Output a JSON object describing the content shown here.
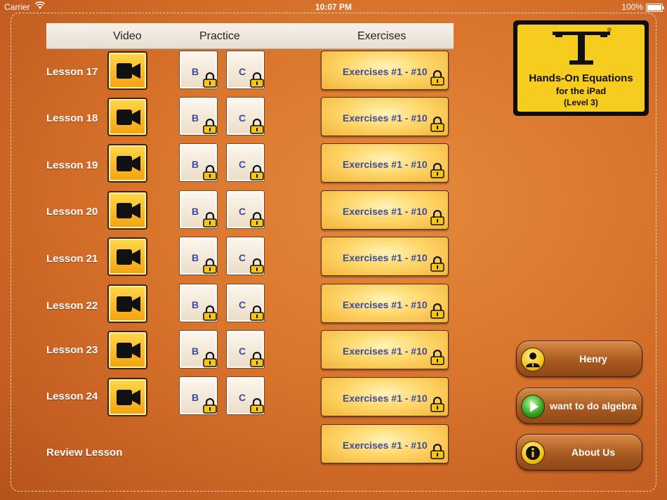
{
  "status_bar": {
    "carrier": "Carrier",
    "time": "10:07 PM",
    "battery": "100%"
  },
  "header": {
    "video": "Video",
    "practice": "Practice",
    "exercises": "Exercises"
  },
  "lessons": [
    {
      "label": "Lesson 17",
      "practice": [
        "B",
        "C"
      ],
      "exercises": "Exercises #1 - #10"
    },
    {
      "label": "Lesson 18",
      "practice": [
        "B",
        "C"
      ],
      "exercises": "Exercises #1 - #10"
    },
    {
      "label": "Lesson 19",
      "practice": [
        "B",
        "C"
      ],
      "exercises": "Exercises #1 - #10"
    },
    {
      "label": "Lesson 20",
      "practice": [
        "B",
        "C"
      ],
      "exercises": "Exercises #1 - #10"
    },
    {
      "label": "Lesson 21",
      "practice": [
        "B",
        "C"
      ],
      "exercises": "Exercises #1 - #10"
    },
    {
      "label": "Lesson 22",
      "practice": [
        "B",
        "C"
      ],
      "exercises": "Exercises #1 - #10"
    },
    {
      "label": "Lesson 23",
      "practice": [
        "B",
        "C"
      ],
      "exercises": "Exercises #1 - #10"
    },
    {
      "label": "Lesson 24",
      "practice": [
        "B",
        "C"
      ],
      "exercises": "Exercises #1 - #10"
    }
  ],
  "review": {
    "label": "Review Lesson",
    "exercises": "Exercises #1 - #10"
  },
  "logo": {
    "title": "Hands-On Equations",
    "subtitle": "for the iPad",
    "level": "(Level 3)"
  },
  "side_buttons": {
    "user": "Henry",
    "play": "want to do algebra",
    "about": "About Us"
  },
  "colors": {
    "accent": "#f5c20e",
    "label_blue": "#3b4aa0",
    "background": "#d9742c"
  }
}
